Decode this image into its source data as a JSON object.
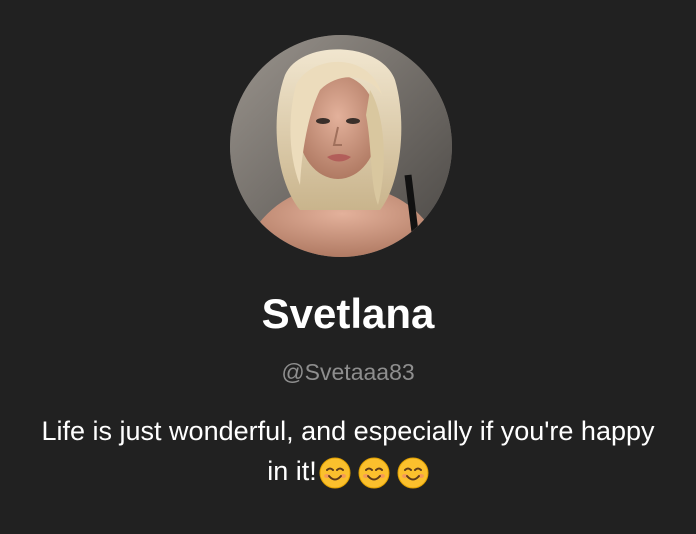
{
  "profile": {
    "display_name": "Svetlana",
    "handle": "@Svetaaa83",
    "bio_line_1": "Life is just wonderful, and especially if you're happy",
    "bio_line_2": "in it!",
    "bio_emojis": [
      "smiling-face-icon",
      "smiling-face-icon",
      "smiling-face-icon"
    ]
  },
  "colors": {
    "background": "#212121",
    "name_text": "#ffffff",
    "handle_text": "#8e8e8e",
    "bio_text": "#ffffff",
    "emoji_face": "#fbc02d"
  }
}
